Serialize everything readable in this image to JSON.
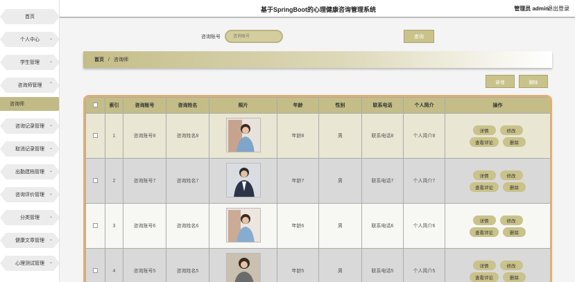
{
  "header": {
    "title": "基于SpringBoot的心理健康咨询管理系统",
    "user": "管理员 admin",
    "logout": "退出登录"
  },
  "sidebar": {
    "items": [
      {
        "label": "首页",
        "chevron": false
      },
      {
        "label": "个人中心",
        "chevron": true
      },
      {
        "label": "学生管理",
        "chevron": true
      },
      {
        "label": "咨询师管理",
        "chevron": true
      },
      {
        "label": "咨询师",
        "chevron": false,
        "active": true
      },
      {
        "label": "咨询记录管理",
        "chevron": true
      },
      {
        "label": "取消记录管理",
        "chevron": true
      },
      {
        "label": "出勤建档管理",
        "chevron": true
      },
      {
        "label": "咨询评价管理",
        "chevron": true
      },
      {
        "label": "分类管理",
        "chevron": true
      },
      {
        "label": "健康文章管理",
        "chevron": true
      },
      {
        "label": "心理测试管理",
        "chevron": true
      }
    ]
  },
  "search": {
    "label": "咨询账号",
    "placeholder": "咨询账号",
    "button": "查询"
  },
  "breadcrumb": {
    "home": "首页",
    "separator": "/",
    "current": "咨询师"
  },
  "actions": {
    "add": "新增",
    "delete": "删除"
  },
  "table": {
    "headers": [
      "",
      "索引",
      "咨询账号",
      "咨询姓名",
      "照片",
      "年龄",
      "性别",
      "联系电话",
      "个人简介",
      "操作"
    ],
    "row_actions": {
      "detail": "详情",
      "edit": "修改",
      "reviews": "查看评论",
      "delete": "删除"
    },
    "rows": [
      {
        "index": "1",
        "account": "咨询账号8",
        "name": "咨询姓名8",
        "age": "年龄8",
        "gender": "男",
        "phone": "联系电话8",
        "intro": "个人简介8"
      },
      {
        "index": "2",
        "account": "咨询账号7",
        "name": "咨询姓名7",
        "age": "年龄7",
        "gender": "男",
        "phone": "联系电话7",
        "intro": "个人简介7"
      },
      {
        "index": "3",
        "account": "咨询账号6",
        "name": "咨询姓名6",
        "age": "年龄6",
        "gender": "男",
        "phone": "联系电话6",
        "intro": "个人简介6"
      },
      {
        "index": "4",
        "account": "咨询账号5",
        "name": "咨询姓名5",
        "age": "年龄5",
        "gender": "男",
        "phone": "联系电话5",
        "intro": "个人简介5"
      }
    ]
  },
  "colors": {
    "accent": "#c4bd88",
    "button": "#c9c28a",
    "table_border": "#e2ae73"
  }
}
